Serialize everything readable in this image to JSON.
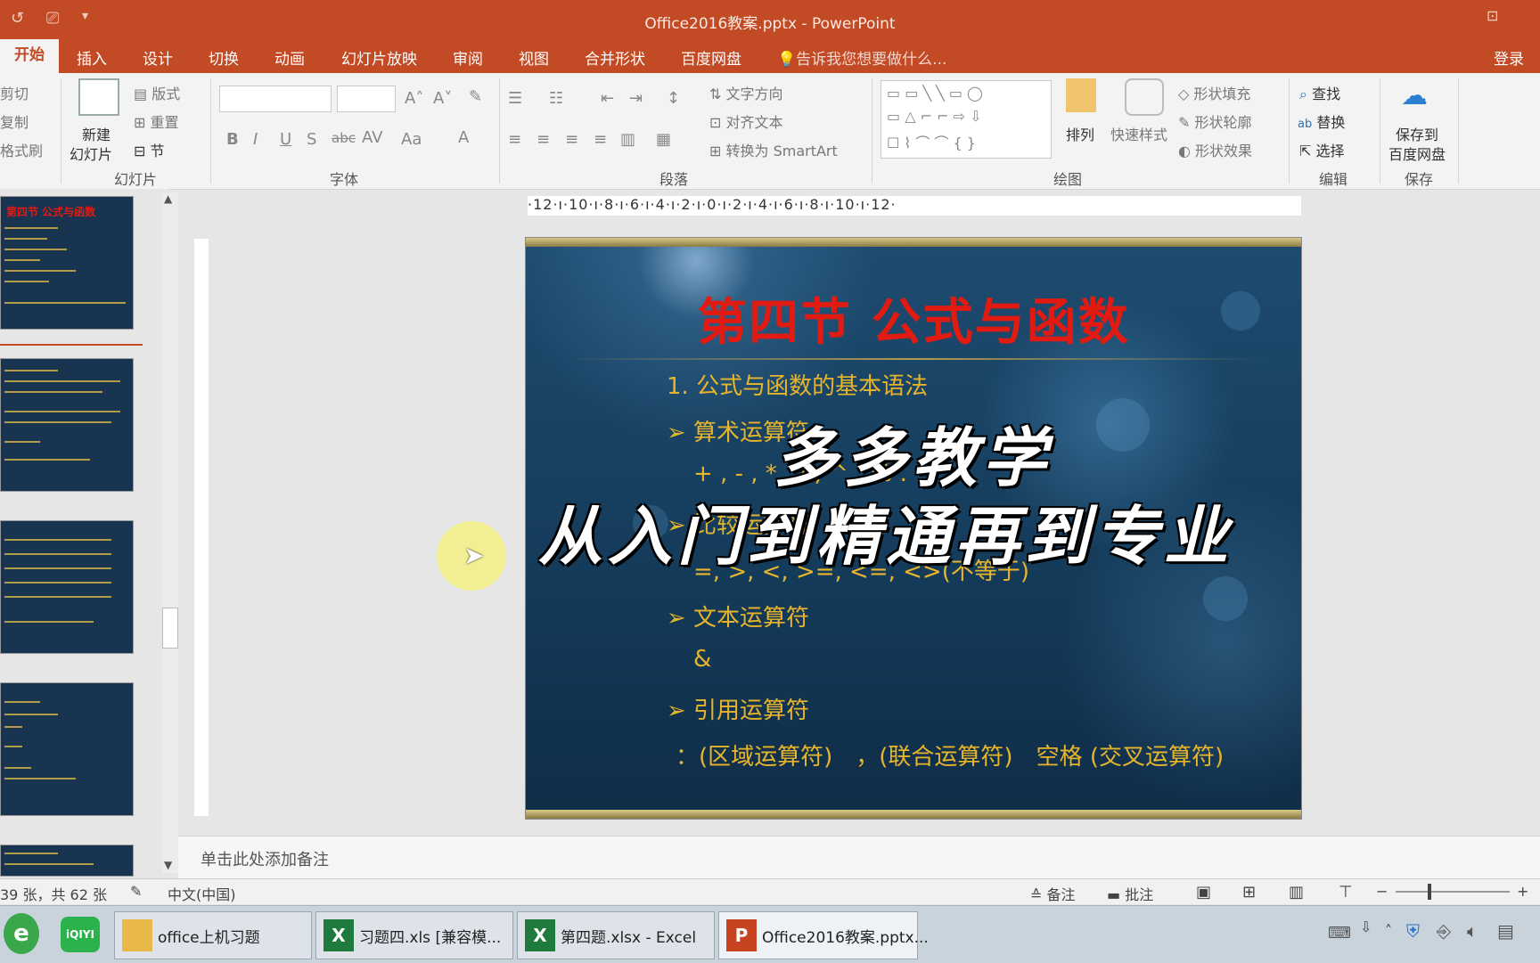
{
  "window": {
    "title": "Office2016教案.pptx - PowerPoint",
    "login": "登录"
  },
  "tabs": [
    "开始",
    "插入",
    "设计",
    "切换",
    "动画",
    "幻灯片放映",
    "审阅",
    "视图",
    "合并形状",
    "百度网盘"
  ],
  "tell_me": "告诉我您想要做什么...",
  "ribbon": {
    "clipboard": {
      "cut": "剪切",
      "copy": "复制",
      "format_painter": "格式刷"
    },
    "slides": {
      "new_slide_l1": "新建",
      "new_slide_l2": "幻灯片",
      "layout": "版式",
      "reset": "重置",
      "section": "节",
      "group": "幻灯片"
    },
    "font": {
      "group": "字体"
    },
    "paragraph": {
      "text_direction": "文字方向",
      "align_text": "对齐文本",
      "smartart": "转换为 SmartArt",
      "group": "段落"
    },
    "drawing": {
      "arrange": "排列",
      "quick_styles": "快速样式",
      "shape_fill": "形状填充",
      "shape_outline": "形状轮廓",
      "shape_effects": "形状效果",
      "group": "绘图"
    },
    "editing": {
      "find": "查找",
      "replace": "替换",
      "select": "选择",
      "group": "编辑"
    },
    "save": {
      "l1": "保存到",
      "l2": "百度网盘",
      "group": "保存"
    }
  },
  "ruler": {
    "horizontal": "·12·ı·10·ı·8·ı·6·ı·4·ı·2·ı·0·ı·2·ı·4·ı·6·ı·8·ı·10·ı·12·"
  },
  "slide": {
    "title": "第四节 公式与函数",
    "lines": [
      "1. 公式与函数的基本语法",
      "➢ 算术运算符",
      "+ , - , * , / , ^ , % .",
      "➢ 比较运算符",
      "=, >, <, >=, <=, <>(不等于)",
      "➢ 文本运算符",
      "&",
      "➢ 引用运算符",
      "：(区域运算符)　，(联合运算符)　空格 (交叉运算符)"
    ],
    "overlay_line1": "多多教学",
    "overlay_line2": "从入门到精通再到专业"
  },
  "thumbs": {
    "first_title": "第四节 公式与函数"
  },
  "notes_placeholder": "单击此处添加备注",
  "status": {
    "slide_count": "39 张，共 62 张",
    "language": "中文(中国)",
    "notes": "备注",
    "comments": "批注"
  },
  "taskbar": {
    "iqiyi": "iQIYI",
    "items": [
      "office上机习题",
      "习题四.xls [兼容模...",
      "第四题.xlsx - Excel",
      "Office2016教案.pptx..."
    ]
  }
}
